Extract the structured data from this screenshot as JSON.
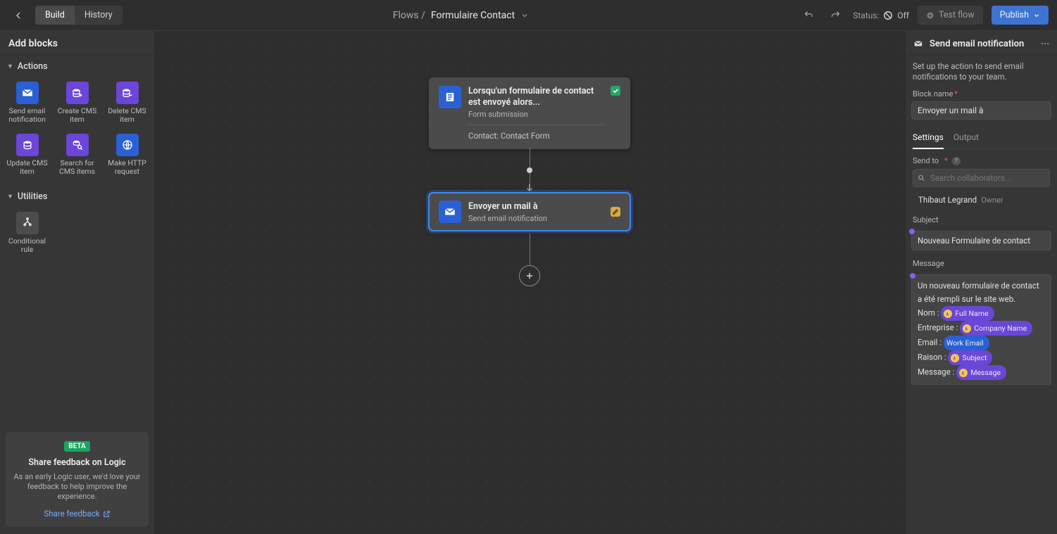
{
  "topbar": {
    "tabs": {
      "build": "Build",
      "history": "History"
    },
    "title_prefix": "Flows / ",
    "title": "Formulaire Contact",
    "status_label": "Status:",
    "status_value": "Off",
    "test_flow": "Test flow",
    "publish": "Publish"
  },
  "left": {
    "header": "Add blocks",
    "sections": {
      "actions": "Actions",
      "utilities": "Utilities"
    },
    "blocks": {
      "send_email": "Send email notification",
      "create_cms": "Create CMS item",
      "delete_cms": "Delete CMS item",
      "update_cms": "Update CMS item",
      "search_cms": "Search for CMS items",
      "http": "Make HTTP request",
      "conditional": "Conditional rule"
    },
    "feedback": {
      "badge": "BETA",
      "title": "Share feedback on Logic",
      "text": "As an early Logic user, we'd love your feedback to help improve the experience.",
      "link": "Share feedback"
    }
  },
  "canvas": {
    "node1": {
      "title": "Lorsqu'un formulaire de contact est envoyé alors...",
      "subtitle": "Form submission",
      "extra": "Contact: Contact Form"
    },
    "node2": {
      "title": "Envoyer un mail à",
      "subtitle": "Send email notification"
    }
  },
  "right": {
    "heading": "Send email notification",
    "description": "Set up the action to send email notifications to your team.",
    "block_name_label": "Block name",
    "block_name_value": "Envoyer un mail à",
    "tabs": {
      "settings": "Settings",
      "output": "Output"
    },
    "send_to_label": "Send to",
    "search_placeholder": "Search collaborators...",
    "collaborator": {
      "name": "Thibaut Legrand",
      "role": "Owner"
    },
    "subject_label": "Subject",
    "subject_value": "Nouveau Formulaire de contact",
    "message_label": "Message",
    "message_intro": "Un nouveau formulaire de contact a été rempli sur le site web.",
    "msg_lines": {
      "nom": "Nom : ",
      "nom_tok": "Full Name",
      "entreprise": "Entreprise : ",
      "entreprise_tok": "Company Name",
      "email": "Email : ",
      "email_tok": "Work Email",
      "raison": "Raison : ",
      "raison_tok": "Subject",
      "message": "Message : ",
      "message_tok": "Message"
    }
  }
}
